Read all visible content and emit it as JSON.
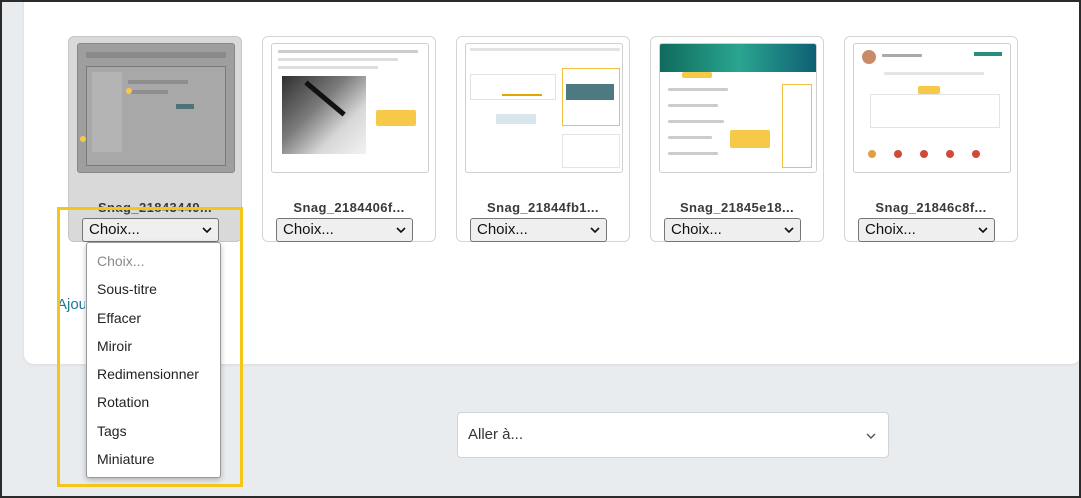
{
  "files": [
    {
      "name": "Snag_21843449...",
      "thumbnail": "screenshot-file-picker",
      "selected": "Choix..."
    },
    {
      "name": "Snag_2184406f...",
      "thumbnail": "pen-signing-document",
      "selected": "Choix..."
    },
    {
      "name": "Snag_21844fb1...",
      "thumbnail": "dashboard-calendar",
      "selected": "Choix..."
    },
    {
      "name": "Snag_21845e18...",
      "thumbnail": "course-sections",
      "selected": "Choix..."
    },
    {
      "name": "Snag_21846c8f...",
      "thumbnail": "user-profile",
      "selected": "Choix..."
    }
  ],
  "dropdown": {
    "placeholder": "Choix...",
    "options": [
      "Sous-titre",
      "Effacer",
      "Miroir",
      "Redimensionner",
      "Rotation",
      "Tags",
      "Miniature"
    ]
  },
  "add_link": "Ajou",
  "jump_to": {
    "placeholder": "Aller à..."
  },
  "colors": {
    "highlight": "#f5c518",
    "link": "#1b7a94",
    "callout": "#f7c948"
  }
}
